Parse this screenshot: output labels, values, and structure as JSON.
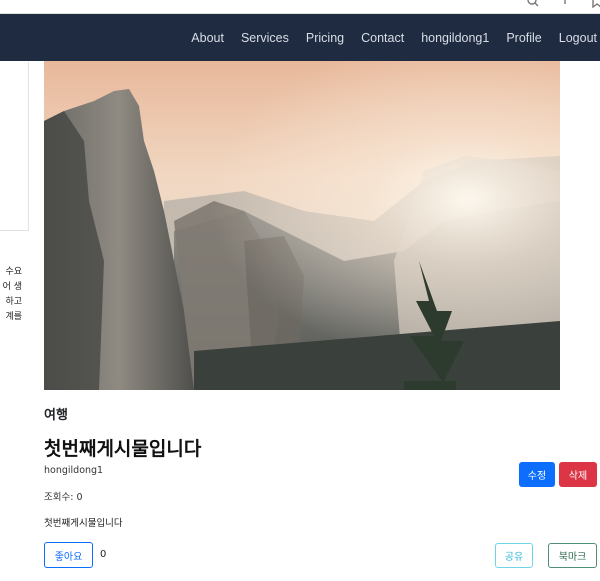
{
  "nav": {
    "links": [
      "About",
      "Services",
      "Pricing",
      "Contact",
      "hongildong1",
      "Profile",
      "Logout"
    ]
  },
  "left_card": {
    "text_lines": [
      "수요",
      "어 생",
      "하고",
      "계를"
    ]
  },
  "post": {
    "category": "여행",
    "title": "첫번째게시물입니다",
    "author": "hongildong1",
    "views": "조회수: 0",
    "body": "첫번째게시물입니다",
    "edit_label": "수정",
    "delete_label": "삭제",
    "like_label": "좋아요",
    "like_count": "0",
    "share_label": "공유",
    "bookmark_label": "북마크"
  },
  "colors": {
    "navbar": "#1f2b41",
    "primary": "#0d6efd",
    "danger": "#dc3545",
    "info": "#3bb9d8",
    "success_outline": "#2e6b50"
  }
}
